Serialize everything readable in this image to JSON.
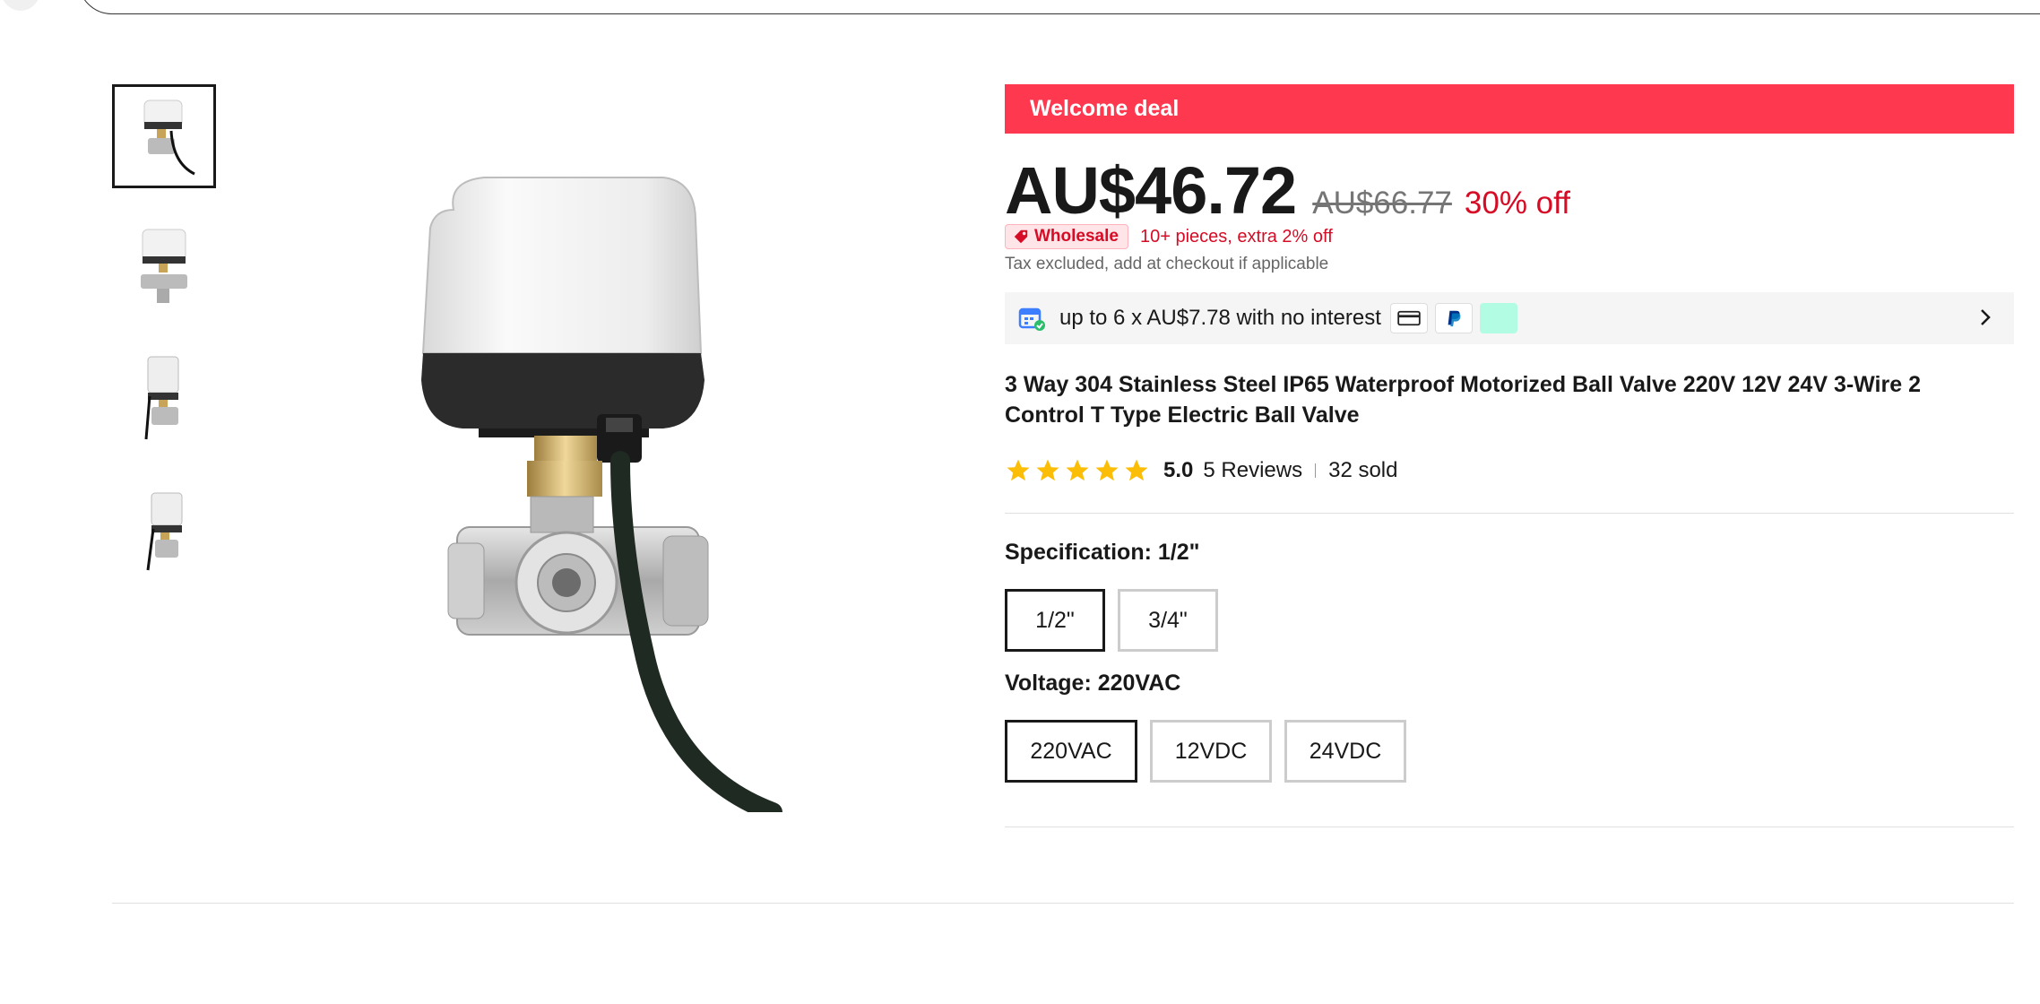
{
  "deal": {
    "banner": "Welcome deal"
  },
  "price": {
    "current": "AU$46.72",
    "original": "AU$66.77",
    "discount": "30% off"
  },
  "wholesale": {
    "badge": "Wholesale",
    "offer": "10+ pieces, extra 2% off"
  },
  "tax_note": "Tax excluded, add at checkout if applicable",
  "installments": {
    "text": "up to 6 x AU$7.78 with no interest",
    "payment_icons": [
      "card-icon",
      "paypal-icon",
      "afterpay-icon"
    ]
  },
  "product": {
    "title": "3 Way 304 Stainless Steel IP65 Waterproof Motorized Ball Valve 220V 12V 24V 3-Wire 2 Control T Type Electric Ball Valve",
    "rating": "5.0",
    "stars": 5,
    "reviews": "5 Reviews",
    "sold": "32 sold"
  },
  "options": {
    "specification": {
      "label": "Specification: 1/2\"",
      "values": [
        "1/2\"",
        "3/4\""
      ],
      "selected": "1/2\""
    },
    "voltage": {
      "label": "Voltage: 220VAC",
      "values": [
        "220VAC",
        "12VDC",
        "24VDC"
      ],
      "selected": "220VAC"
    }
  },
  "gallery": {
    "thumbnail_count": 4,
    "active_index": 0
  },
  "colors": {
    "accent_red": "#fd384f",
    "price_red": "#d60b25",
    "star_gold": "#fcbd06",
    "text": "#191919"
  }
}
